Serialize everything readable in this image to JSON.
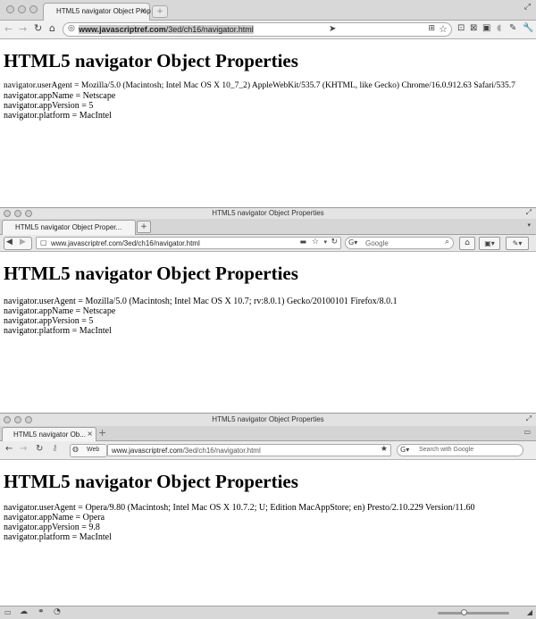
{
  "chrome": {
    "tab_title": "HTML5 navigator Object Prop",
    "new_tab": "+",
    "url_domain": "www.javascriptref.com",
    "url_path": "/3ed/ch16/navigator.html"
  },
  "firefox": {
    "window_title": "HTML5 navigator Object Properties",
    "tab_title": "HTML5 navigator Object Proper...",
    "new_tab": "+",
    "url": "www.javascriptref.com/3ed/ch16/navigator.html",
    "search_placeholder": "Google"
  },
  "opera": {
    "window_title": "HTML5 navigator Object Properties",
    "tab_title": "HTML5 navigator Ob...",
    "new_tab": "+",
    "web_badge": "Web",
    "url_domain": "www.javascriptref.com",
    "url_path": "/3ed/ch16/navigator.html",
    "search_placeholder": "Search with Google"
  },
  "page_heading": "HTML5 navigator Object Properties",
  "chrome_page": {
    "userAgent": "navigator.userAgent = Mozilla/5.0 (Macintosh; Intel Mac OS X 10_7_2) AppleWebKit/535.7 (KHTML, like Gecko) Chrome/16.0.912.63 Safari/535.7",
    "appName": "navigator.appName = Netscape",
    "appVersion": "navigator.appVersion = 5",
    "platform": "navigator.platform = MacIntel"
  },
  "firefox_page": {
    "userAgent": "navigator.userAgent = Mozilla/5.0 (Macintosh; Intel Mac OS X 10.7; rv:8.0.1) Gecko/20100101 Firefox/8.0.1",
    "appName": "navigator.appName = Netscape",
    "appVersion": "navigator.appVersion = 5",
    "platform": "navigator.platform = MacIntel"
  },
  "opera_page": {
    "userAgent": "navigator.userAgent = Opera/9.80 (Macintosh; Intel Mac OS X 10.7.2; U; Edition MacAppStore; en) Presto/2.10.229 Version/11.60",
    "appName": "navigator.appName = Opera",
    "appVersion": "navigator.appVersion = 9.8",
    "platform": "navigator.platform = MacIntel"
  },
  "colors": {
    "toolbar_gray": "#dcdcdc",
    "title_gray": "#e6e6e6",
    "border": "#9a9a9a"
  }
}
